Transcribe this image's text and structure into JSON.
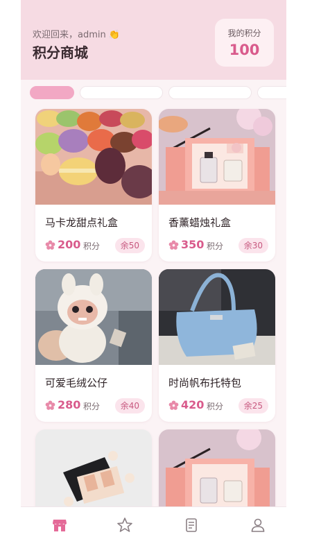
{
  "header": {
    "welcome": "欢迎回来，admin 👏",
    "title": "积分商城",
    "points_label": "我的积分",
    "points_value": "100"
  },
  "products": [
    {
      "name": "马卡龙甜点礼盒",
      "points": "200",
      "unit": "积分",
      "stock": "余50"
    },
    {
      "name": "香薰蜡烛礼盒",
      "points": "350",
      "unit": "积分",
      "stock": "余30"
    },
    {
      "name": "可爱毛绒公仔",
      "points": "280",
      "unit": "积分",
      "stock": "余40"
    },
    {
      "name": "时尚帆布托特包",
      "points": "420",
      "unit": "积分",
      "stock": "余25"
    }
  ],
  "colors": {
    "accent": "#d95b8c",
    "header_bg": "#f6dbe3",
    "tab_active": "#f2a8c4"
  },
  "navbar": {
    "items": [
      "store-icon",
      "star-icon",
      "document-icon",
      "user-icon"
    ]
  }
}
